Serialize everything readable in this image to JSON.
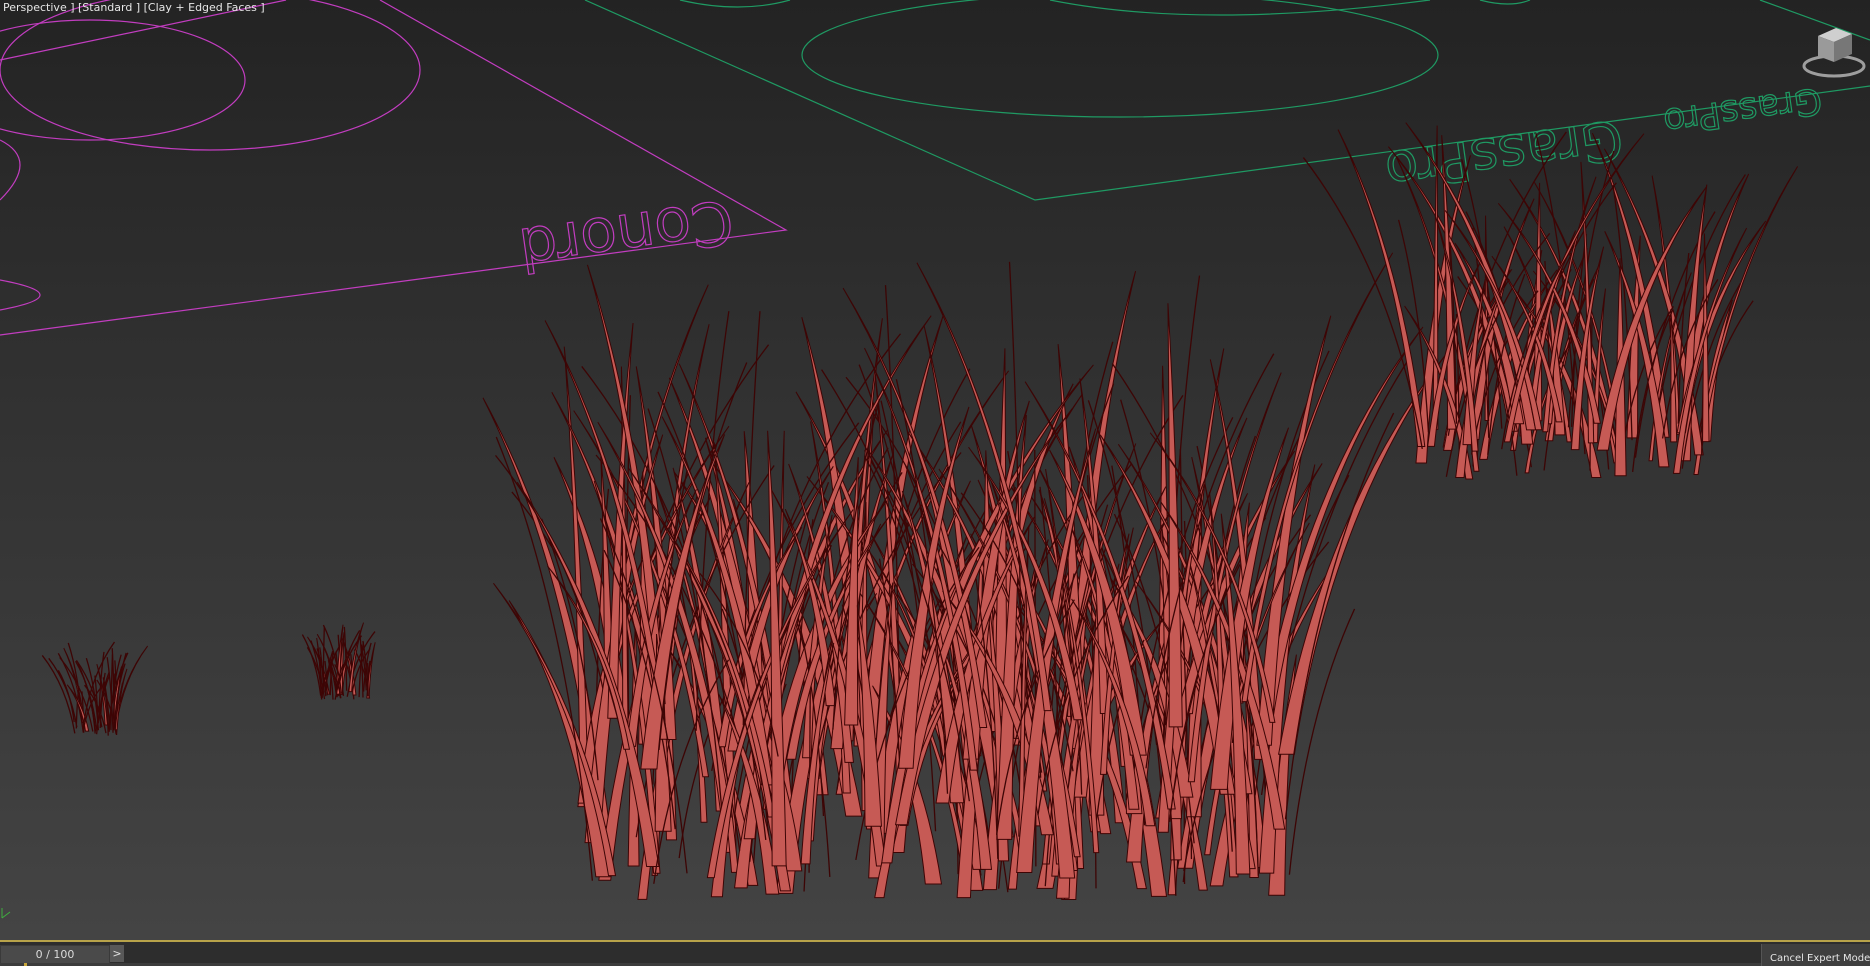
{
  "viewport": {
    "label_parts": [
      "Perspective ]",
      "[Standard ]",
      "[Clay + Edged Faces ]"
    ],
    "plane_text_left": "Conord",
    "plane_text_right": "GrassPro",
    "colors": {
      "left_plane": "#c23dc0",
      "right_plane": "#1f9a63",
      "grass_fill": "#c65a55",
      "grass_edge": "#3d0505"
    }
  },
  "timeline": {
    "frame_display": "0 / 100",
    "next_label": ">",
    "cancel_label": "Cancel Expert Mode"
  }
}
